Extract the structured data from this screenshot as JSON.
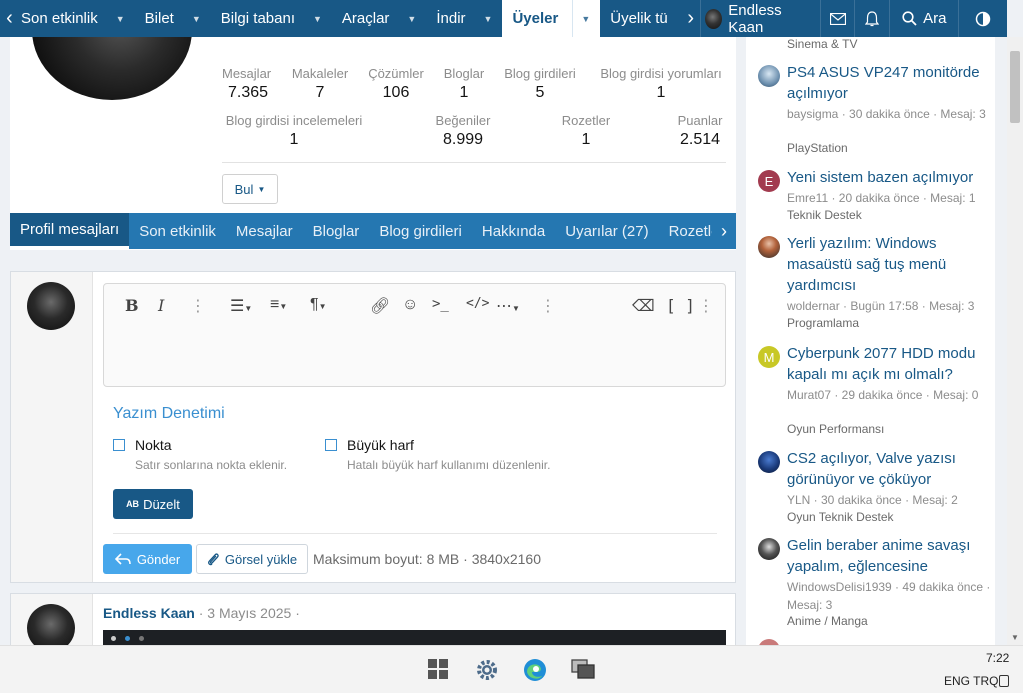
{
  "topnav": {
    "items": [
      {
        "label": "Son etkinlik"
      },
      {
        "label": "Bilet"
      },
      {
        "label": "Bilgi tabanı"
      },
      {
        "label": "Araçlar"
      },
      {
        "label": "İndir"
      },
      {
        "label": "Üyeler"
      },
      {
        "label": "Üyelik tü"
      }
    ],
    "user_name": "Endless Kaan",
    "search_label": "Ara",
    "colors": {
      "bar": "#185886",
      "active_text": "#185886"
    }
  },
  "profile": {
    "stats_row1": [
      {
        "label": "Mesajlar",
        "value": "7.365"
      },
      {
        "label": "Makaleler",
        "value": "7"
      },
      {
        "label": "Çözümler",
        "value": "106"
      },
      {
        "label": "Bloglar",
        "value": "1"
      },
      {
        "label": "Blog girdileri",
        "value": "5"
      },
      {
        "label": "Blog girdisi yorumları",
        "value": "1"
      }
    ],
    "stats_row2": [
      {
        "label": "Blog girdisi incelemeleri",
        "value": "1"
      },
      {
        "label": "Beğeniler",
        "value": "8.999"
      },
      {
        "label": "Rozetler",
        "value": "1"
      },
      {
        "label": "Puanlar",
        "value": "2.514"
      }
    ],
    "find_button": "Bul"
  },
  "tabs": [
    {
      "label": "Profil mesajları"
    },
    {
      "label": "Son etkinlik"
    },
    {
      "label": "Mesajlar"
    },
    {
      "label": "Bloglar"
    },
    {
      "label": "Blog girdileri"
    },
    {
      "label": "Hakkında"
    },
    {
      "label": "Uyarılar (27)"
    },
    {
      "label": "Rozetle"
    }
  ],
  "editor": {
    "spellcheck_title": "Yazım Denetimi",
    "option1": {
      "label": "Nokta",
      "desc": "Satır sonlarına nokta eklenir."
    },
    "option2": {
      "label": "Büyük harf",
      "desc": "Hatalı büyük harf kullanımı düzenlenir."
    },
    "fix_button": "Düzelt",
    "fix_icon_text": "AB",
    "send_button": "Gönder",
    "upload_button": "Görsel yükle",
    "max_size": "Maksimum boyut: 8 MB · 3840x2160"
  },
  "post": {
    "author": "Endless Kaan",
    "date": "· 3 Mayıs 2025 ·"
  },
  "sidebar": {
    "top_cat": "Sinema & TV",
    "items": [
      {
        "title": "PS4 ASUS VP247 monitörde açılmıyor",
        "meta": "baysigma · 30 dakika önce · Mesaj: 3",
        "cat": "PlayStation",
        "avatar_letter": ""
      },
      {
        "title": "Yeni sistem bazen açılmıyor",
        "meta": "Emre11 · 20 dakika önce · Mesaj: 1",
        "cat": "Teknik Destek",
        "avatar_letter": "E"
      },
      {
        "title": "Yerli yazılım: Windows masaüstü sağ tuş menü yardımcısı",
        "meta": "woldernar · Bugün 17:58 · Mesaj: 3",
        "cat": "Programlama",
        "avatar_letter": ""
      },
      {
        "title": "Cyberpunk 2077 HDD modu kapalı mı açık mı olmalı?",
        "meta": "Murat07 · 29 dakika önce · Mesaj: 0",
        "cat": "Oyun Performansı",
        "avatar_letter": "M"
      },
      {
        "title": "CS2 açılıyor, Valve yazısı görünüyor ve çöküyor",
        "meta": "YLN · 30 dakika önce · Mesaj: 2",
        "cat": "Oyun Teknik Destek",
        "avatar_letter": ""
      },
      {
        "title": "Gelin beraber anime savaşı yapalım, eğlencesine",
        "meta": "WindowsDelisi1939 · 49 dakika önce · Mesaj: 3",
        "cat": "Anime / Manga",
        "avatar_letter": ""
      }
    ]
  },
  "taskbar": {
    "time": "7:22",
    "lang": "ENG TRQ"
  }
}
